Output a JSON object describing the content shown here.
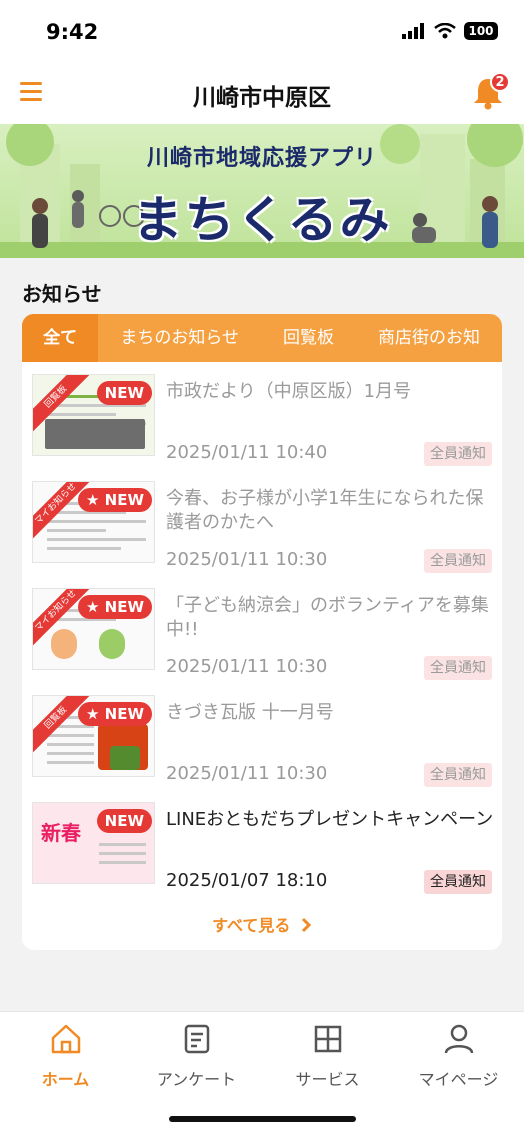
{
  "status": {
    "time": "9:42",
    "battery": "100"
  },
  "header": {
    "title": "川崎市中原区",
    "notification_count": "2"
  },
  "banner": {
    "subtitle": "川崎市地域応援アプリ",
    "title": "まちくるみ"
  },
  "news": {
    "section_title": "お知らせ",
    "tabs": [
      "全て",
      "まちのお知らせ",
      "回覧板",
      "商店街のお知"
    ],
    "new_label": "NEW",
    "items": [
      {
        "title": "市政だより（中原区版）1月号",
        "date": "2025/01/11 10:40",
        "tag": "全員通知",
        "ribbon": "回覧板",
        "unread": false
      },
      {
        "title": "今春、お子様が小学1年生になられた保護者のかたへ",
        "date": "2025/01/11 10:30",
        "tag": "全員通知",
        "ribbon": "マイお知らせ",
        "unread": false
      },
      {
        "title": "「子ども納涼会」のボランティアを募集中!!",
        "date": "2025/01/11 10:30",
        "tag": "全員通知",
        "ribbon": "マイお知らせ",
        "unread": false
      },
      {
        "title": "きづき瓦版 十一月号",
        "date": "2025/01/11 10:30",
        "tag": "全員通知",
        "ribbon": "回覧板",
        "unread": false
      },
      {
        "title": "LINEおともだちプレゼントキャンペーン",
        "date": "2025/01/07 18:10",
        "tag": "全員通知",
        "ribbon": "",
        "unread": true
      }
    ],
    "see_all": "すべて見る"
  },
  "bottom_nav": [
    {
      "label": "ホーム",
      "icon": "home-icon",
      "active": true
    },
    {
      "label": "アンケート",
      "icon": "survey-icon",
      "active": false
    },
    {
      "label": "サービス",
      "icon": "services-icon",
      "active": false
    },
    {
      "label": "マイページ",
      "icon": "person-icon",
      "active": false
    }
  ],
  "colors": {
    "accent": "#f08a24",
    "tab_bar": "#f5a142",
    "badge": "#e53935"
  }
}
